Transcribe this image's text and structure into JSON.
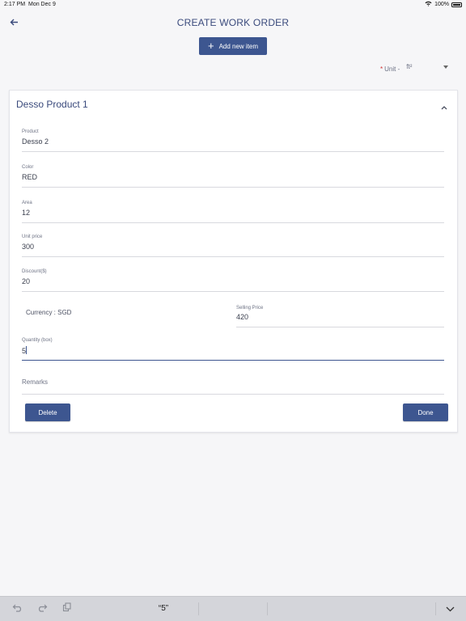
{
  "status_bar": {
    "time": "2:17 PM",
    "date": "Mon Dec 9",
    "battery": "100%"
  },
  "header": {
    "title": "CREATE WORK ORDER"
  },
  "add_item": {
    "label": "Add new item"
  },
  "unit": {
    "required_mark": "*",
    "label": "Unit -",
    "value": "ft²"
  },
  "product_card": {
    "title": "Desso Product 1",
    "fields": {
      "product": {
        "label": "Product",
        "value": "Desso 2"
      },
      "color": {
        "label": "Color",
        "value": "RED"
      },
      "area": {
        "label": "Area",
        "value": "12"
      },
      "unit_price": {
        "label": "Unit price",
        "value": "300"
      },
      "discount": {
        "label": "Discount($)",
        "value": "20"
      },
      "currency": "Currency : SGD",
      "selling_price": {
        "label": "Selling Price",
        "value": "420"
      },
      "quantity": {
        "label": "Quantity (box)",
        "value": "5"
      },
      "remarks": {
        "label": "Remarks"
      }
    },
    "delete_label": "Delete",
    "done_label": "Done"
  },
  "keyboard_bar": {
    "suggestion": "“5”"
  },
  "colors": {
    "primary": "#3d5690",
    "title": "#3a4a7c",
    "required": "#d03030"
  }
}
